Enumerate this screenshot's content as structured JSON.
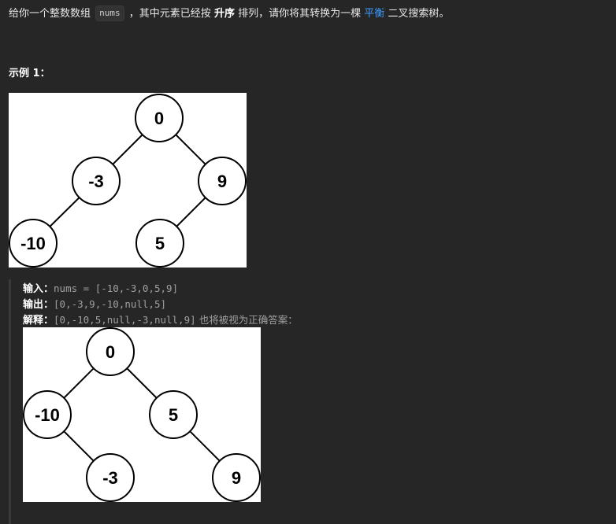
{
  "description": {
    "part1": "给你一个整数数组",
    "code": "nums",
    "part2": "，其中元素已经按",
    "bold": "升序",
    "part3": "排列，请你将其转换为一棵",
    "link": "平衡",
    "part4": "二叉搜索树。"
  },
  "example": {
    "title": "示例 1：",
    "tree1_nodes": [
      "0",
      "-3",
      "9",
      "-10",
      "5"
    ],
    "input_label": "输入：",
    "input_value": "nums = [-10,-3,0,5,9]",
    "output_label": "输出：",
    "output_value": "[0,-3,9,-10,null,5]",
    "explain_label": "解释：",
    "explain_value": "[0,-10,5,null,-3,null,9]",
    "explain_tail": "也将被视为正确答案：",
    "tree2_nodes": [
      "0",
      "-10",
      "5",
      "-3",
      "9"
    ]
  },
  "colors": {
    "background": "#262626",
    "link": "#3b9cff",
    "muted": "#a0a0a0"
  }
}
